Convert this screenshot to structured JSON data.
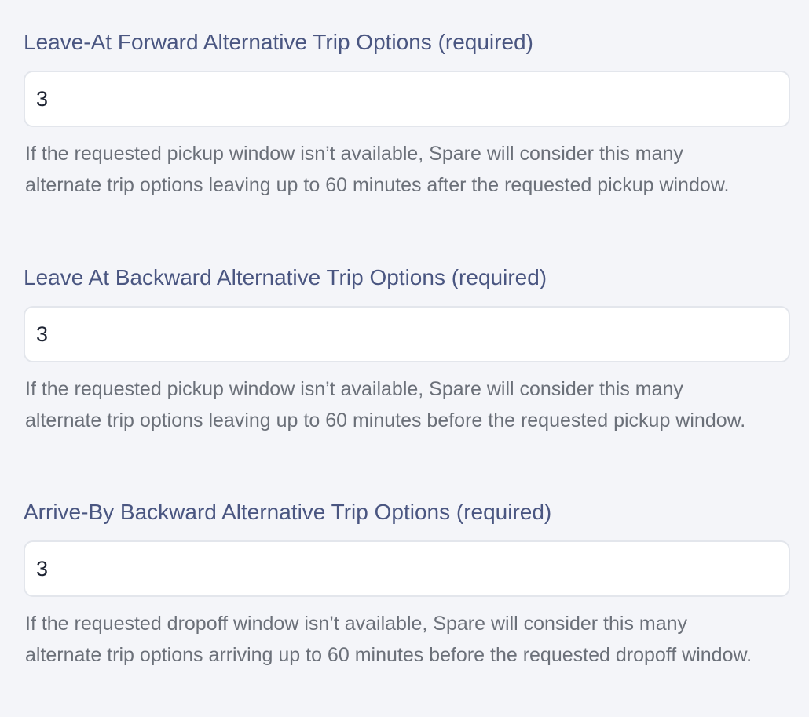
{
  "fields": [
    {
      "label": "Leave-At Forward Alternative Trip Options (required)",
      "value": "3",
      "help": "If the requested pickup window isn’t available, Spare will consider this many alternate trip options leaving up to 60 minutes after the requested pickup window."
    },
    {
      "label": "Leave At Backward Alternative Trip Options (required)",
      "value": "3",
      "help": "If the requested pickup window isn’t available, Spare will consider this many alternate trip options leaving up to 60 minutes before the requested pickup window."
    },
    {
      "label": "Arrive-By Backward Alternative Trip Options (required)",
      "value": "3",
      "help": "If the requested dropoff window isn’t available, Spare will consider this many alternate trip options arriving up to 60 minutes before the requested dropoff window."
    }
  ]
}
